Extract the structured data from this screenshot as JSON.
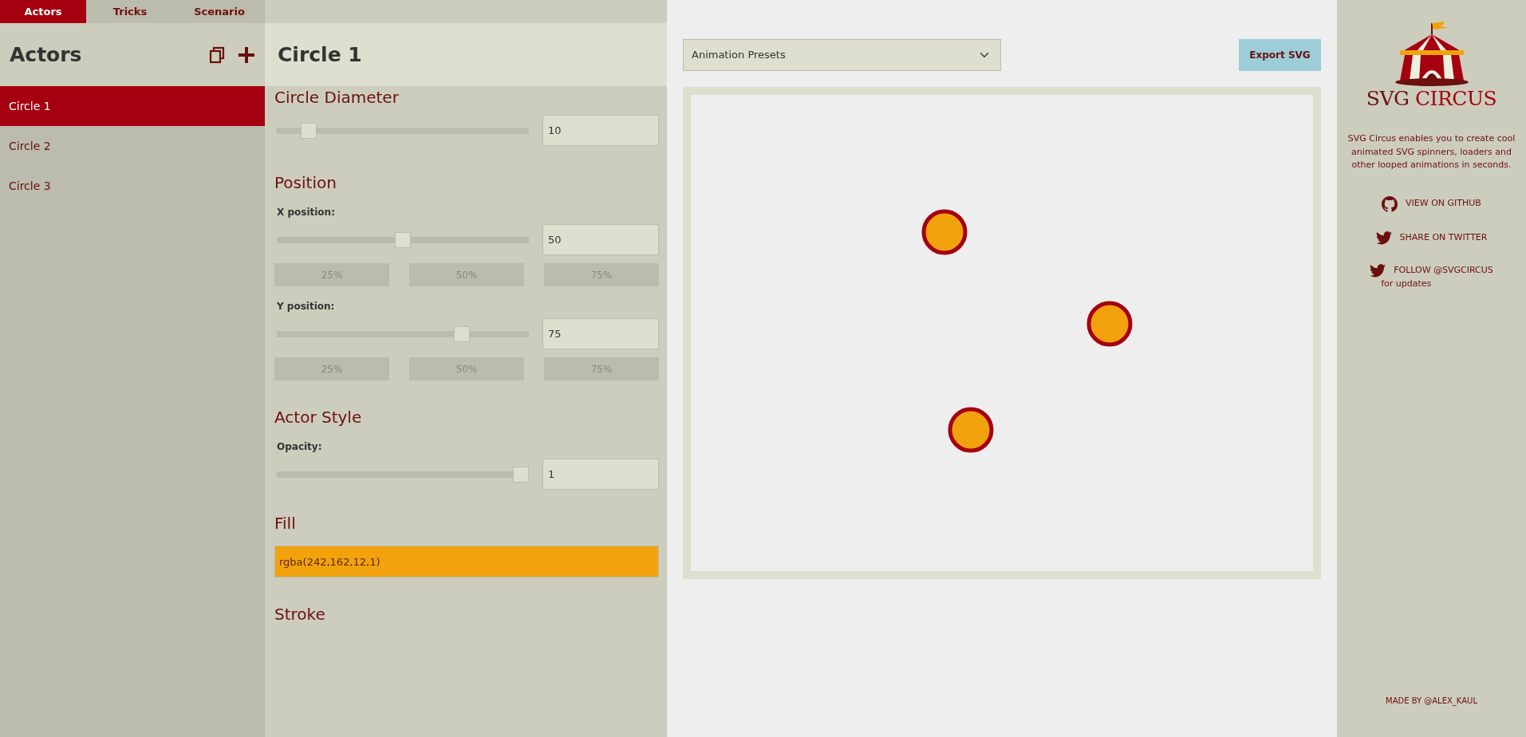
{
  "tabs": [
    {
      "label": "Actors",
      "selected": true
    },
    {
      "label": "Tricks",
      "selected": false
    },
    {
      "label": "Scenario",
      "selected": false
    }
  ],
  "sidebar": {
    "title": "Actors",
    "items": [
      {
        "label": "Circle 1",
        "selected": true
      },
      {
        "label": "Circle 2",
        "selected": false
      },
      {
        "label": "Circle 3",
        "selected": false
      }
    ]
  },
  "editor": {
    "title": "Circle 1",
    "sections": [
      {
        "kind": "slider",
        "heading": "Circle Diameter",
        "level": 0.1,
        "value": "10"
      },
      {
        "kind": "heading",
        "heading": "Position"
      },
      {
        "kind": "slider",
        "label": "X position:",
        "level": 0.5,
        "value": "50",
        "presets": [
          "25%",
          "50%",
          "75%"
        ]
      },
      {
        "kind": "slider",
        "label": "Y position:",
        "level": 0.75,
        "value": "75",
        "presets": [
          "25%",
          "50%",
          "75%"
        ]
      },
      {
        "kind": "heading",
        "heading": "Actor Style"
      },
      {
        "kind": "slider",
        "label": "Opacity:",
        "level": 1,
        "value": "1"
      },
      {
        "kind": "color",
        "heading": "Fill",
        "value": "rgba(242,162,12,1)",
        "color": "#f2a20c"
      },
      {
        "kind": "heading",
        "heading": "Stroke"
      }
    ]
  },
  "toolbar": {
    "preset_select": "Animation Presets",
    "export_button": "Export SVG"
  },
  "about": {
    "logo_first": "SVG",
    "logo_second": "CIRCUS",
    "description": "SVG Circus enables you to create cool animated SVG spinners, loaders and other looped animations in seconds.",
    "links": [
      {
        "kind": "github",
        "label": "VIEW ON GITHUB"
      },
      {
        "kind": "twitter",
        "label": "SHARE ON TWITTER"
      },
      {
        "kind": "twitter",
        "label": "FOLLOW @SVGCIRCUS",
        "note": "for updates"
      }
    ],
    "credit": "MADE BY @ALEX_KAUL"
  }
}
